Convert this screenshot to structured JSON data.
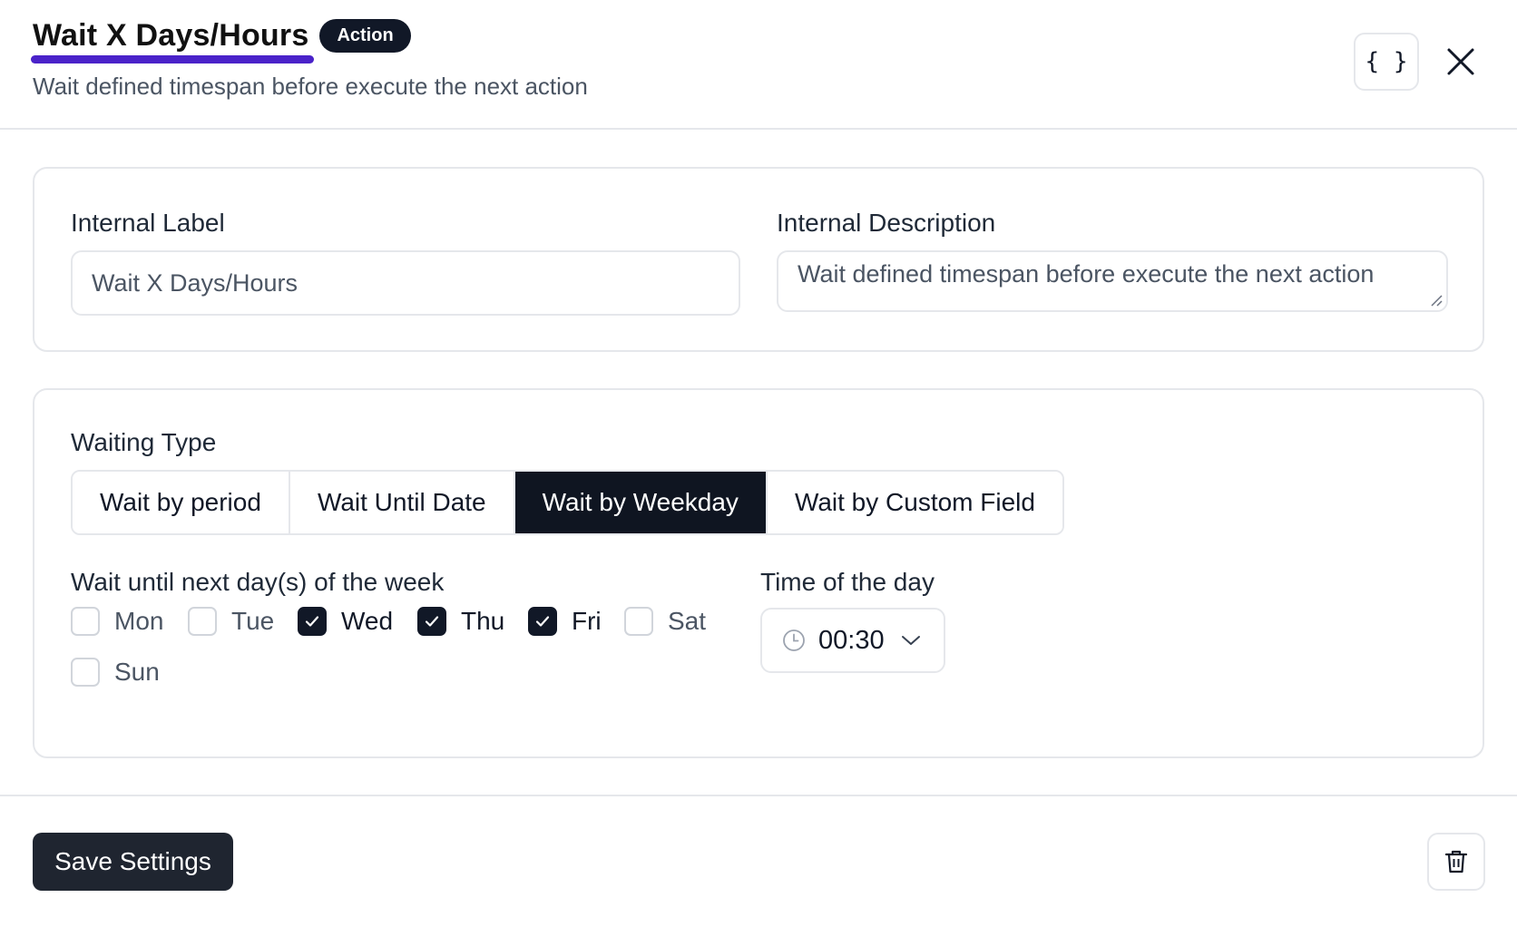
{
  "header": {
    "title": "Wait X Days/Hours",
    "badge": "Action",
    "subtitle": "Wait defined timespan before execute the next action",
    "code_button_label": "{ }",
    "accent_color": "#4a22c9"
  },
  "general": {
    "label_title": "Internal Label",
    "label_value": "Wait X Days/Hours",
    "description_title": "Internal Description",
    "description_value": "Wait defined timespan before execute the next action"
  },
  "waiting": {
    "type_title": "Waiting Type",
    "tabs": [
      {
        "label": "Wait by period",
        "active": false
      },
      {
        "label": "Wait Until Date",
        "active": false
      },
      {
        "label": "Wait by Weekday",
        "active": true
      },
      {
        "label": "Wait by Custom Field",
        "active": false
      }
    ],
    "days_title": "Wait until next day(s) of the week",
    "days": [
      {
        "label": "Mon",
        "checked": false
      },
      {
        "label": "Tue",
        "checked": false
      },
      {
        "label": "Wed",
        "checked": true
      },
      {
        "label": "Thu",
        "checked": true
      },
      {
        "label": "Fri",
        "checked": true
      },
      {
        "label": "Sat",
        "checked": false
      },
      {
        "label": "Sun",
        "checked": false
      }
    ],
    "time_title": "Time of the day",
    "time_value": "00:30"
  },
  "footer": {
    "save_label": "Save Settings"
  },
  "icons": {
    "code": "code-braces-icon",
    "close": "close-icon",
    "clock": "clock-icon",
    "chevron": "chevron-down-icon",
    "trash": "trash-icon",
    "check": "check-icon"
  }
}
